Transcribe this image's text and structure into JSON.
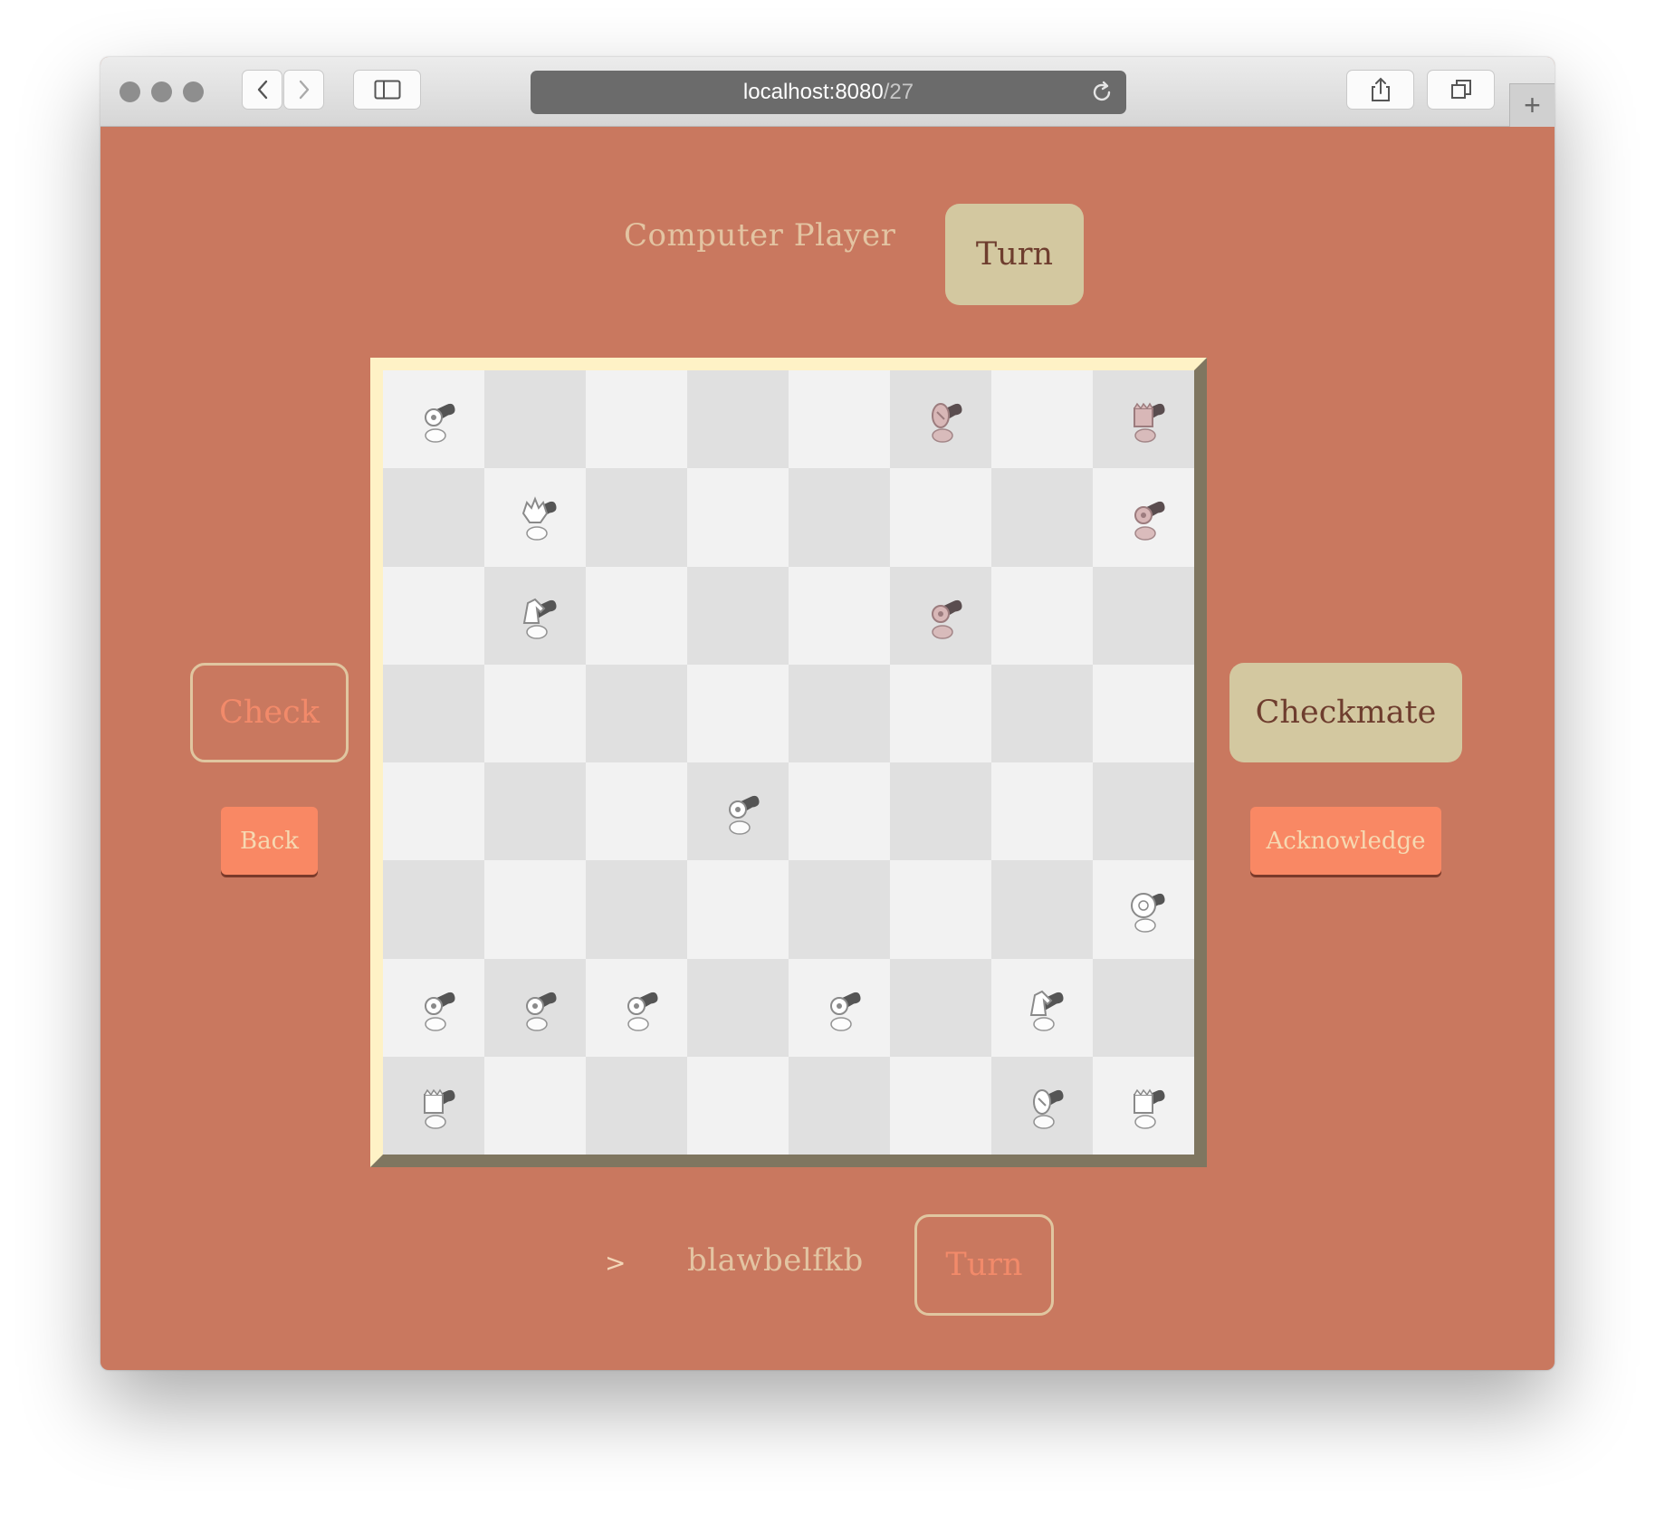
{
  "browser": {
    "url_host": "localhost:8080",
    "url_path": "/27"
  },
  "top_player": {
    "name": "Computer Player",
    "turn_label": "Turn"
  },
  "bottom_player": {
    "prompt": ">",
    "name": "blawbelfkb",
    "turn_label": "Turn"
  },
  "left_actions": {
    "check_label": "Check",
    "back_label": "Back"
  },
  "right_actions": {
    "checkmate_label": "Checkmate",
    "acknowledge_label": "Acknowledge"
  },
  "board": {
    "colors": {
      "light_square": "#f2f2f2",
      "dark_square": "#e0e0e0",
      "frame": "#fef2c6",
      "frame_shadow": "#7f7660",
      "page_background": "#c9785f"
    },
    "pieces": [
      {
        "row": 0,
        "col": 0,
        "color": "white",
        "type": "pawn"
      },
      {
        "row": 0,
        "col": 5,
        "color": "dark",
        "type": "bishop"
      },
      {
        "row": 0,
        "col": 7,
        "color": "dark",
        "type": "rook"
      },
      {
        "row": 1,
        "col": 1,
        "color": "white",
        "type": "king"
      },
      {
        "row": 1,
        "col": 7,
        "color": "dark",
        "type": "pawn"
      },
      {
        "row": 2,
        "col": 1,
        "color": "white",
        "type": "knight"
      },
      {
        "row": 2,
        "col": 5,
        "color": "dark",
        "type": "pawn"
      },
      {
        "row": 4,
        "col": 3,
        "color": "white",
        "type": "pawn"
      },
      {
        "row": 5,
        "col": 7,
        "color": "white",
        "type": "queen"
      },
      {
        "row": 6,
        "col": 0,
        "color": "white",
        "type": "pawn"
      },
      {
        "row": 6,
        "col": 1,
        "color": "white",
        "type": "pawn"
      },
      {
        "row": 6,
        "col": 2,
        "color": "white",
        "type": "pawn"
      },
      {
        "row": 6,
        "col": 4,
        "color": "white",
        "type": "pawn"
      },
      {
        "row": 6,
        "col": 6,
        "color": "white",
        "type": "knight"
      },
      {
        "row": 7,
        "col": 0,
        "color": "white",
        "type": "rook"
      },
      {
        "row": 7,
        "col": 6,
        "color": "white",
        "type": "bishop"
      },
      {
        "row": 7,
        "col": 7,
        "color": "white",
        "type": "rook"
      }
    ]
  }
}
